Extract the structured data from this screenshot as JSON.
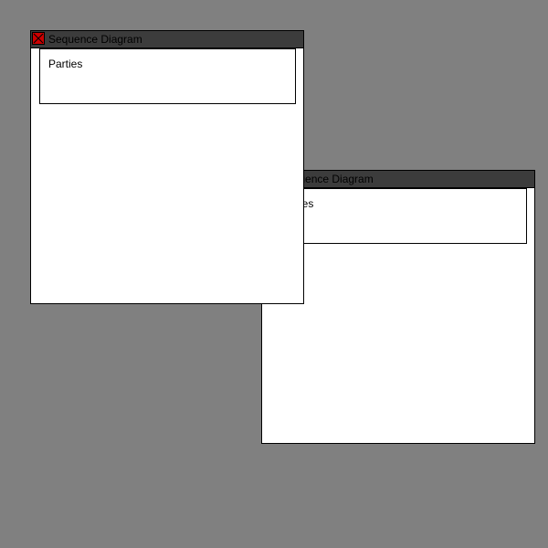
{
  "windows": [
    {
      "title": "Sequence Diagram",
      "frame_label": "Parties"
    },
    {
      "title": "Sequence Diagram",
      "frame_label": "Parties"
    }
  ],
  "colors": {
    "desktop": "#808080",
    "titlebar": "#3c3c3c",
    "close_button": "#cc0000"
  },
  "icons": {
    "close": "close-icon"
  }
}
